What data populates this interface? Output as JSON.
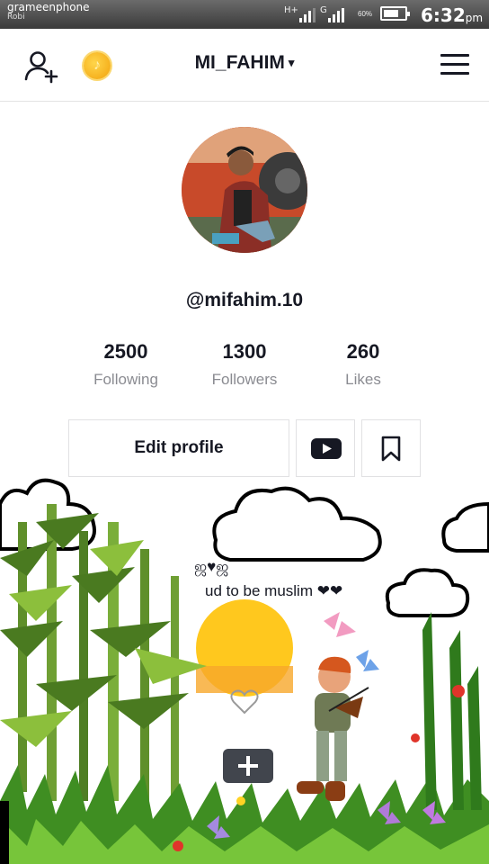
{
  "status_bar": {
    "carrier": "grameenphone",
    "carrier_sub": "Robi",
    "network_1": "H+",
    "network_2": "G",
    "battery_percent": "60%",
    "time": "6:32",
    "time_suffix": "pm"
  },
  "header": {
    "username": "MI_FAHIM",
    "caret": "▾",
    "coin_symbol": "♪",
    "icons": [
      "add-user-icon",
      "coin-icon",
      "menu-icon"
    ]
  },
  "profile": {
    "handle": "@mifahim.10",
    "stats": [
      {
        "value": "2500",
        "label": "Following"
      },
      {
        "value": "1300",
        "label": "Followers"
      },
      {
        "value": "260",
        "label": "Likes"
      }
    ],
    "edit_button": "Edit profile",
    "bio_symbols": "ஜ♥ஜ",
    "bio": "ud to be muslim ❤❤"
  },
  "colors": {
    "text": "#161823",
    "secondary_text": "#8a8b91",
    "border": "#e1e1e3",
    "coin": "#f2a20c"
  }
}
